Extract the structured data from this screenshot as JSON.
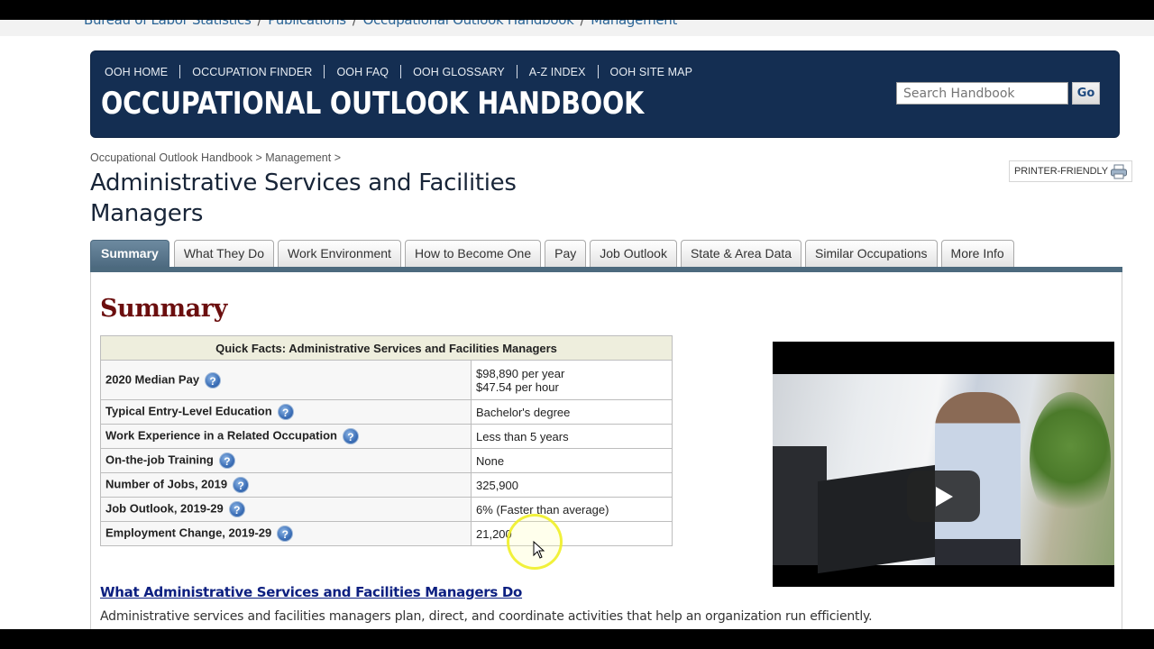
{
  "site_breadcrumb": [
    "Bureau of Labor Statistics",
    "Publications",
    "Occupational Outlook Handbook",
    "Management"
  ],
  "banner": {
    "nav": [
      "OOH HOME",
      "OCCUPATION FINDER",
      "OOH FAQ",
      "OOH GLOSSARY",
      "A-Z INDEX",
      "OOH SITE MAP"
    ],
    "title": "OCCUPATIONAL OUTLOOK HANDBOOK",
    "search_placeholder": "Search Handbook",
    "search_button": "Go"
  },
  "breadcrumb": {
    "items": [
      "Occupational Outlook Handbook",
      "Management"
    ],
    "separator": ">"
  },
  "page_title": "Administrative Services and Facilities Managers",
  "printer_friendly": "PRINTER-FRIENDLY",
  "tabs": [
    {
      "label": "Summary",
      "active": true
    },
    {
      "label": "What They Do",
      "active": false
    },
    {
      "label": "Work Environment",
      "active": false
    },
    {
      "label": "How to Become One",
      "active": false
    },
    {
      "label": "Pay",
      "active": false
    },
    {
      "label": "Job Outlook",
      "active": false
    },
    {
      "label": "State & Area Data",
      "active": false
    },
    {
      "label": "Similar Occupations",
      "active": false
    },
    {
      "label": "More Info",
      "active": false
    }
  ],
  "summary": {
    "heading": "Summary",
    "quick_facts": {
      "title": "Quick Facts: Administrative Services and Facilities Managers",
      "rows": [
        {
          "label": "2020 Median Pay",
          "value": "$98,890 per year",
          "value2": "$47.54 per hour"
        },
        {
          "label": "Typical Entry-Level Education",
          "value": "Bachelor's degree"
        },
        {
          "label": "Work Experience in a Related Occupation",
          "value": "Less than 5 years"
        },
        {
          "label": "On-the-job Training",
          "value": "None"
        },
        {
          "label": "Number of Jobs, 2019",
          "value": "325,900"
        },
        {
          "label": "Job Outlook, 2019-29",
          "value": "6% (Faster than average)"
        },
        {
          "label": "Employment Change, 2019-29",
          "value": "21,200"
        }
      ]
    },
    "what_they_do_link": "What Administrative Services and Facilities Managers Do",
    "what_they_do_text": "Administrative services and facilities managers plan, direct, and coordinate activities that help an organization run efficiently."
  },
  "icons": {
    "help": "?"
  },
  "colors": {
    "banner_bg": "#142e52",
    "active_tab": "#4d6a80",
    "summary_heading": "#6b0e0e",
    "link": "#0c1f80",
    "quick_facts_header": "#eeeedd"
  }
}
